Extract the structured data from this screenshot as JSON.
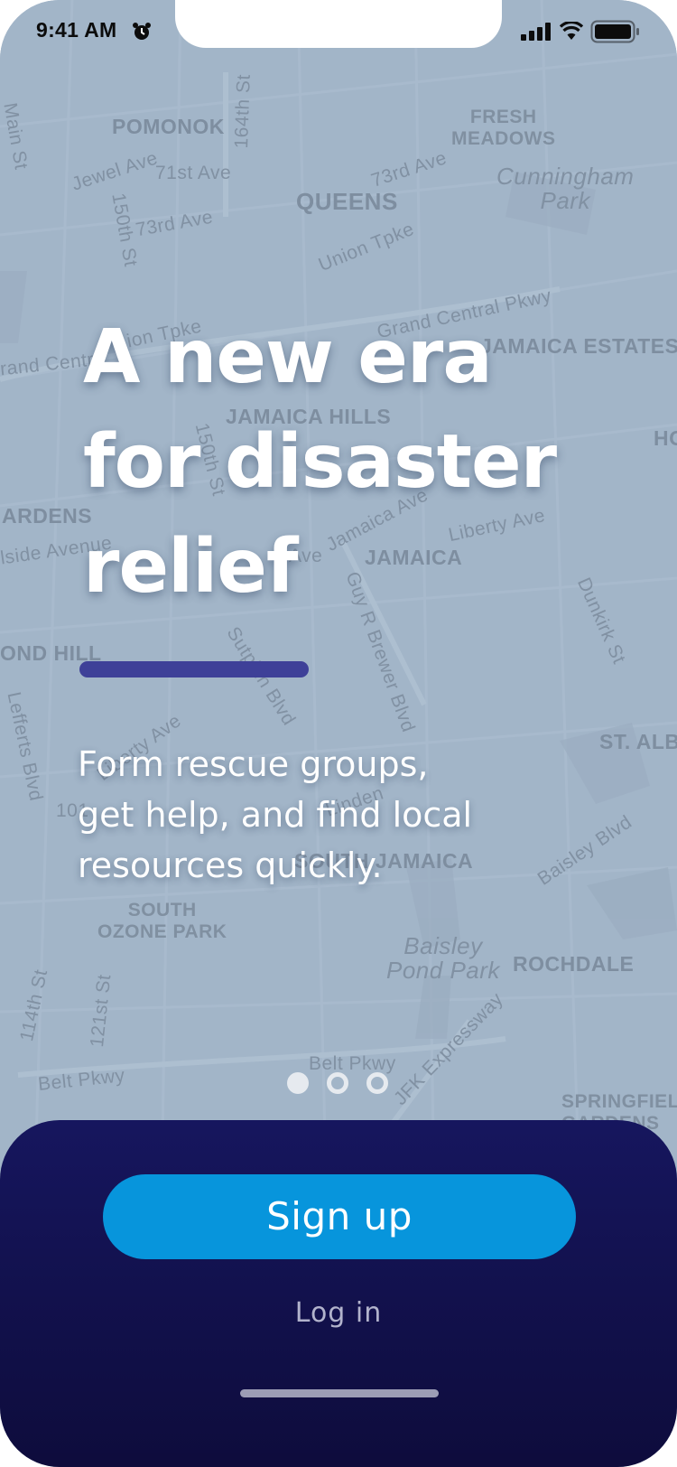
{
  "status_bar": {
    "time": "9:41 AM"
  },
  "map": {
    "labels": [
      "POMONOK",
      "FRESH\nMEADOWS",
      "QUEENS",
      "Cunningham\nPark",
      "JAMAICA ESTATES",
      "JAMAICA HILLS",
      "JAMAICA",
      "ARDENS",
      "OND HILL",
      "ST. ALB",
      "HO",
      "SOUTH JAMAICA",
      "SOUTH\nOZONE PARK",
      "Baisley\nPond Park",
      "ROCHDALE",
      "SPRINGFIEL\nGARDENS",
      "Main St",
      "Jewel Ave",
      "71st Ave",
      "164th St",
      "73rd Ave",
      "150th St",
      "73rd Ave",
      "Union Tpke",
      "Grand Central Pkwy",
      "rand Centr",
      "ion Tpke",
      "150th St",
      "Jamaica Ave",
      "Liberty Ave",
      "lside Avenue",
      "Guy R Brewer Blvd",
      "Dunkirk St",
      "Sutphin Blvd",
      "Lefferts Blvd",
      "Liberty Ave",
      "Baisley Blvd",
      "Linden",
      "114th St",
      "121st St",
      "Belt Pkwy",
      "Belt Pkwy",
      "JFK Expressway",
      "Ave",
      "101"
    ]
  },
  "onboarding": {
    "headline_lines": [
      "A new era",
      "for disaster",
      "relief"
    ],
    "subhead_lines": [
      "Form rescue groups,",
      "get help, and find local",
      "resources quickly."
    ],
    "page_count": 3,
    "active_page": 1
  },
  "actions": {
    "signup_label": "Sign up",
    "login_label": "Log in"
  },
  "colors": {
    "map_bg": "#a2b5c8",
    "accent_bar": "#3e4098",
    "signup_button": "#0795dc",
    "panel_top": "#16165e",
    "panel_bottom": "#0e0c3c"
  }
}
